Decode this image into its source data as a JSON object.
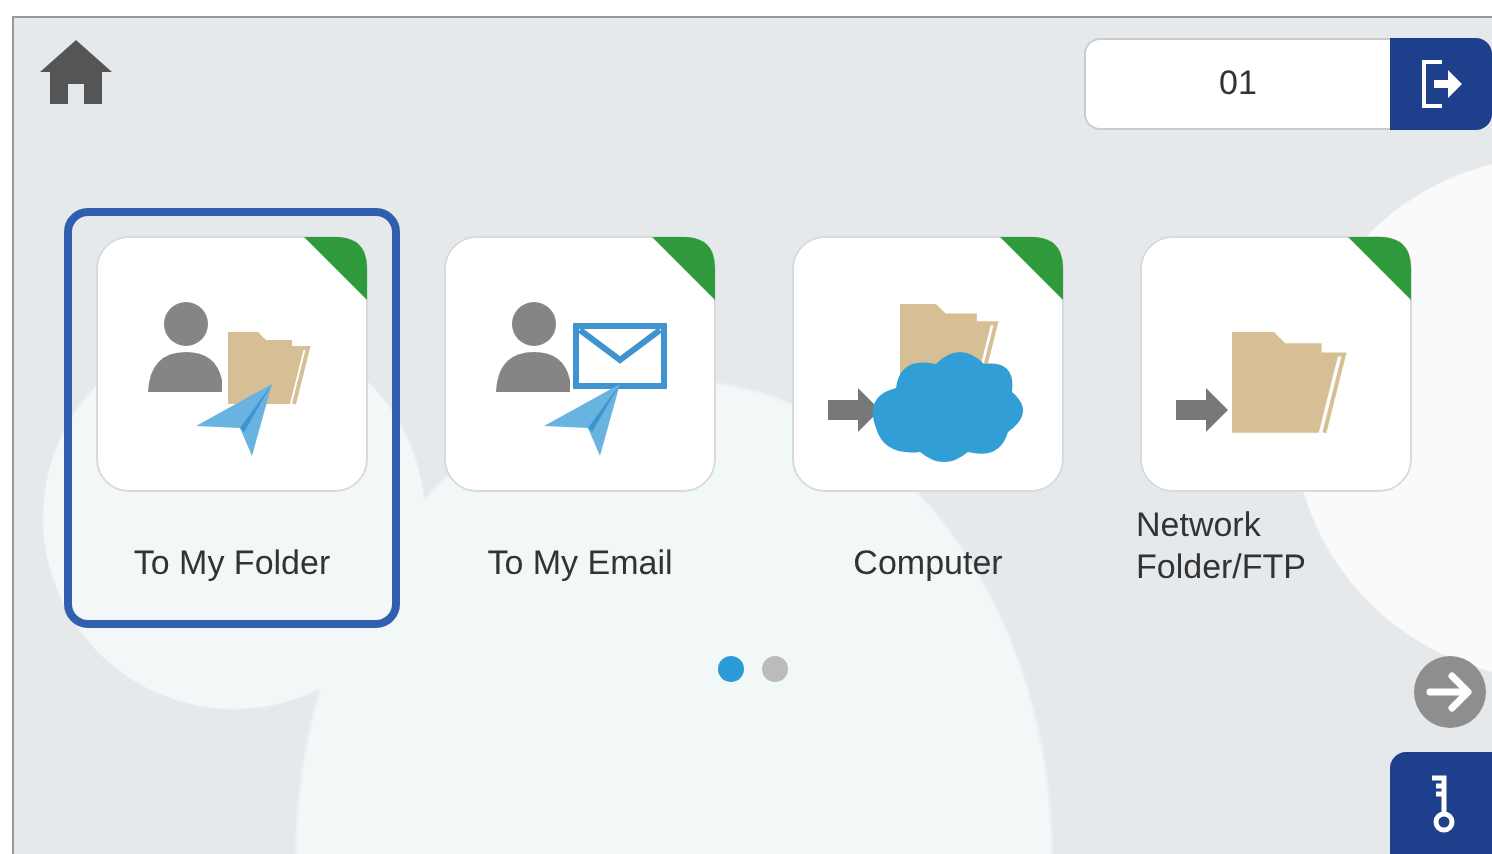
{
  "user_field": {
    "value": "01"
  },
  "tiles": [
    {
      "kind": "person-folder",
      "label": "To My Folder",
      "selected": true
    },
    {
      "kind": "person-email",
      "label": "To My Email",
      "selected": false
    },
    {
      "kind": "cloud",
      "label": "Computer",
      "selected": false
    },
    {
      "kind": "network-folder",
      "label": "Network Folder/FTP",
      "selected": false
    }
  ],
  "page_dots": [
    {
      "selected": true
    },
    {
      "selected": false
    }
  ]
}
